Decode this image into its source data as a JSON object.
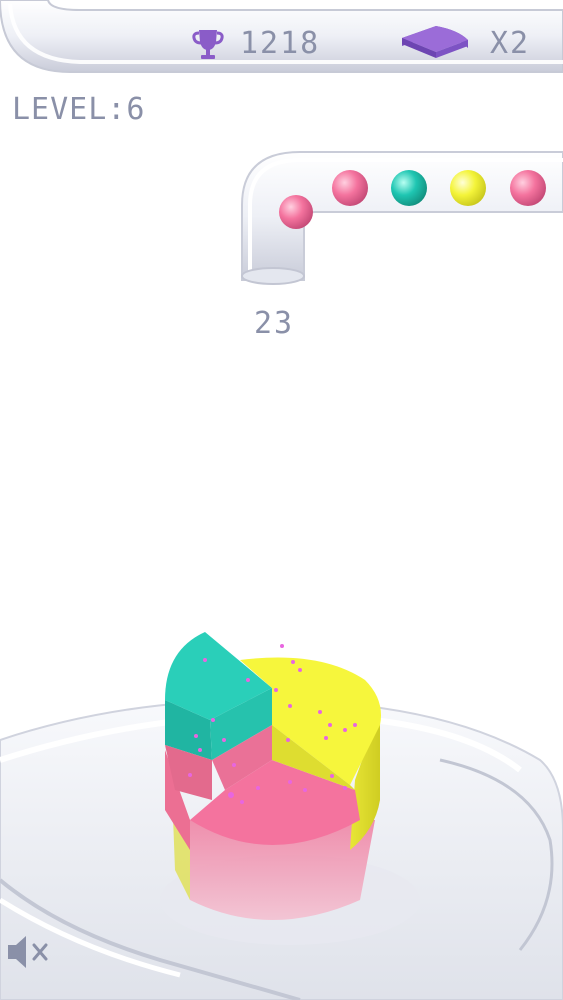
{
  "hud": {
    "score": "1218",
    "multiplier": "X2",
    "level": "LEVEL:6",
    "ball_count": "23"
  },
  "icons": {
    "score": "trophy-icon",
    "multiplier": "pie-slice-icon",
    "sound": "muted-speaker-icon"
  },
  "queue_balls": [
    "pink",
    "pink",
    "cyan",
    "yellow",
    "pink"
  ],
  "cake_slices": [
    {
      "color": "cyan",
      "filled": true
    },
    {
      "color": "yellow",
      "filled": true
    },
    {
      "color": "pink",
      "filled": true
    }
  ],
  "colors": {
    "pink": "#f4739e",
    "cyan": "#22c8b4",
    "yellow": "#f5f53a",
    "accent": "#8a5cc8",
    "hud_text": "#8a90a8"
  }
}
